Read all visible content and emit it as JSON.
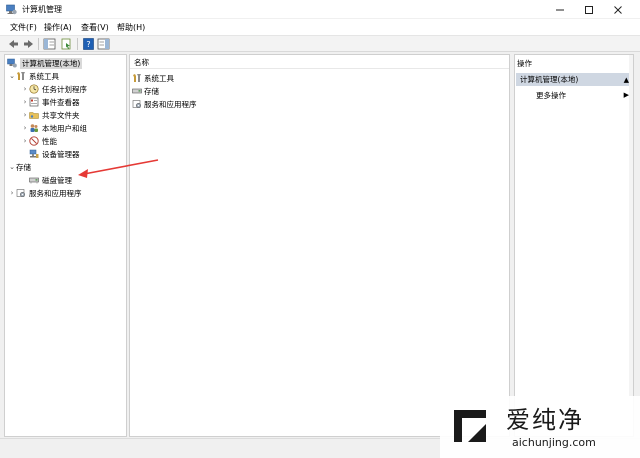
{
  "window": {
    "title": "计算机管理",
    "icons": {
      "app": "computer-management-icon",
      "minimize": "minimize-icon",
      "maximize": "maximize-icon",
      "close": "close-icon"
    }
  },
  "menubar": {
    "items": [
      "文件(F)",
      "操作(A)",
      "查看(V)",
      "帮助(H)"
    ]
  },
  "toolbar": {
    "buttons": [
      "back-icon",
      "forward-icon",
      "show-hide-tree-icon",
      "properties-icon",
      "help-icon",
      "show-action-pane-icon"
    ]
  },
  "tree": {
    "root": "计算机管理(本地)",
    "system_tools": "系统工具",
    "task_scheduler": "任务计划程序",
    "event_viewer": "事件查看器",
    "shared_folders": "共享文件夹",
    "local_users_groups": "本地用户和组",
    "performance": "性能",
    "device_manager": "设备管理器",
    "storage": "存储",
    "disk_management": "磁盘管理",
    "services_apps": "服务和应用程序"
  },
  "list": {
    "header": "名称",
    "items": [
      "系统工具",
      "存储",
      "服务和应用程序"
    ]
  },
  "actions": {
    "header": "操作",
    "section": "计算机管理(本地)",
    "more": "更多操作"
  },
  "watermark": {
    "title": "爱纯净",
    "url": "aichunjing.com"
  },
  "colors": {
    "accent": "#1e73be",
    "annotation_arrow": "#e53935",
    "selection": "#d9d9d9",
    "action_section_bg": "#cfd7e2"
  }
}
